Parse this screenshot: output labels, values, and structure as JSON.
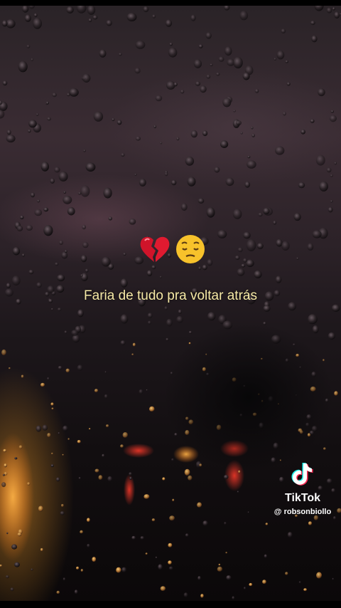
{
  "overlay": {
    "caption": "Faria de tudo pra voltar atrás",
    "emojis": [
      "broken-heart-icon",
      "pensive-face-icon"
    ]
  },
  "watermark": {
    "brand": "TikTok",
    "handle": "@ robsonbiollo",
    "icon": "tiktok-logo-icon"
  },
  "colors": {
    "caption": "#f6e9a6",
    "heart": "#d0142a",
    "face": "#f7c22b"
  }
}
